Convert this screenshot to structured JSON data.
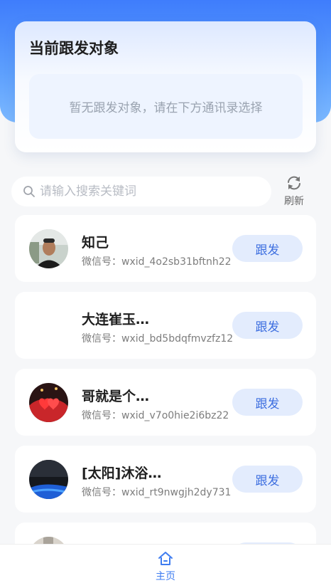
{
  "current_target": {
    "title": "当前跟发对象",
    "empty_text": "暂无跟发对象，请在下方通讯录选择"
  },
  "search": {
    "placeholder": "请输入搜索关键词",
    "value": ""
  },
  "refresh": {
    "label": "刷新",
    "icon": "refresh-icon"
  },
  "contacts": [
    {
      "name": "知己",
      "wxid": "微信号：wxid_4o2sb31bftnh22",
      "button": "跟发",
      "avatar": "photo-man"
    },
    {
      "name": "大连崔玉…",
      "wxid": "微信号：wxid_bd5bdqfmvzfz12",
      "button": "跟发",
      "avatar": "none"
    },
    {
      "name": "哥就是个…",
      "wxid": "微信号：wxid_v7o0hie2i6bz22",
      "button": "跟发",
      "avatar": "photo-hearts"
    },
    {
      "name": "[太阳]沐浴…",
      "wxid": "微信号：wxid_rt9nwgjh2dy731",
      "button": "跟发",
      "avatar": "photo-night"
    },
    {
      "name": "",
      "wxid": "",
      "button": "",
      "avatar": "photo-partial"
    }
  ],
  "tabbar": {
    "home": {
      "label": "主页",
      "icon": "home-icon",
      "color": "#3e7cf0"
    }
  },
  "colors": {
    "header_blue": "#3f7dfc",
    "button_bg": "#e3ecfd",
    "button_text": "#3e6fe0"
  }
}
